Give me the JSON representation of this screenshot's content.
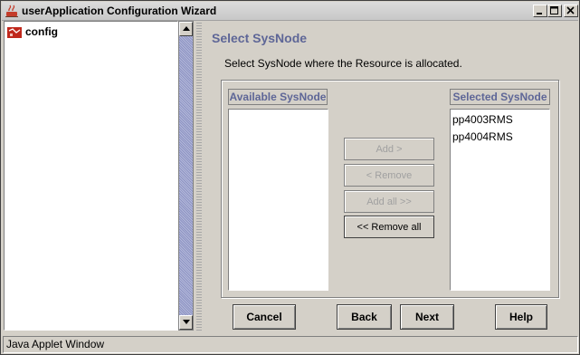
{
  "window": {
    "title": "userApplication Configuration Wizard"
  },
  "title_controls": {
    "minimize": "minimize-icon",
    "maximize": "maximize-icon",
    "close": "close-icon"
  },
  "tree": {
    "root_label": "config",
    "root_icon": "config-icon"
  },
  "page": {
    "heading": "Select SysNode",
    "instruction": "Select SysNode where the Resource is allocated."
  },
  "available": {
    "header": "Available SysNode",
    "items": []
  },
  "selected": {
    "header": "Selected SysNode",
    "items": [
      "pp4003RMS",
      "pp4004RMS"
    ]
  },
  "move_buttons": {
    "add": "Add >",
    "remove": "< Remove",
    "add_all": "Add all >>",
    "remove_all": "<< Remove all"
  },
  "footer": {
    "cancel": "Cancel",
    "back": "Back",
    "next": "Next",
    "help": "Help"
  },
  "status": {
    "text": "Java Applet Window"
  },
  "colors": {
    "heading": "#5e6697",
    "background": "#d4d0c8"
  }
}
